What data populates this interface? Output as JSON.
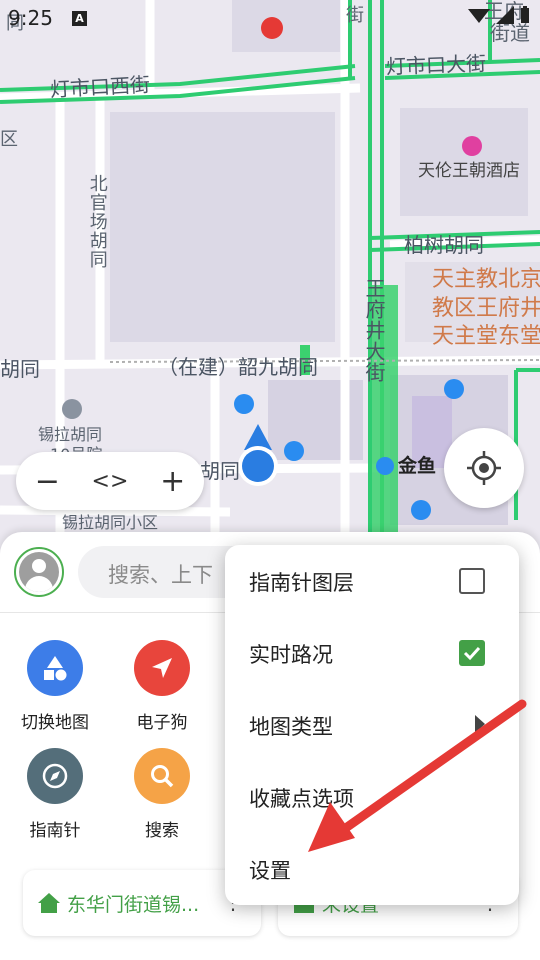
{
  "status_bar": {
    "time": "9:25",
    "notif_letter": "A"
  },
  "map": {
    "roads": {
      "dengshikou_west": "灯市口西街",
      "dengshikou_east": "灯市口大街",
      "beiguanchang": "北官场胡同",
      "bashu": "柏树胡同",
      "wangfujing": "王府井大街",
      "shaojiu": "（在建）韶九胡同",
      "hutong_left": "胡同",
      "hutong_mid": "胡同",
      "xila": "锡拉胡同",
      "xila_num": "10号院",
      "xila_small": "锡拉胡同小区",
      "edge_top_left": "同",
      "edge_top_mid": "街",
      "edge_left_qu": "区",
      "edge_right_top": "王府",
      "edge_right_jiedao": "街道"
    },
    "pois": {
      "hotel": "天伦王朝酒店",
      "church": "天主教北京教区王府井天主堂东堂",
      "metro": "金鱼"
    }
  },
  "controls": {
    "zoom_out": "−",
    "pan": "<>",
    "zoom_in": "+",
    "locate_icon": "crosshair-icon"
  },
  "sheet": {
    "search_placeholder": "搜索、上下",
    "tools": [
      {
        "label": "切换地图",
        "icon": "shapes-icon",
        "color": "#3d7de8"
      },
      {
        "label": "电子狗",
        "icon": "navigation-arrow-icon",
        "color": "#e8453c"
      },
      {
        "label": "指南针",
        "icon": "compass-icon",
        "color": "#546e7a"
      },
      {
        "label": "搜索",
        "icon": "search-icon",
        "color": "#f5a347"
      }
    ],
    "cards": [
      {
        "text": "东华门街道锡...",
        "icon": "home-icon",
        "color": "#43a047"
      },
      {
        "text": "未设置",
        "icon": "building-icon",
        "color": "#43a047"
      }
    ]
  },
  "menu": {
    "items": [
      {
        "label": "指南针图层",
        "control": "checkbox",
        "checked": false
      },
      {
        "label": "实时路况",
        "control": "checkbox",
        "checked": true
      },
      {
        "label": "地图类型",
        "control": "submenu"
      },
      {
        "label": "收藏点选项",
        "control": "none"
      },
      {
        "label": "设置",
        "control": "none"
      }
    ]
  },
  "colors": {
    "traffic_green": "#2ecc71",
    "accent_green": "#43a047",
    "location_blue": "#2a7de1",
    "arrow_red": "#e53935"
  }
}
